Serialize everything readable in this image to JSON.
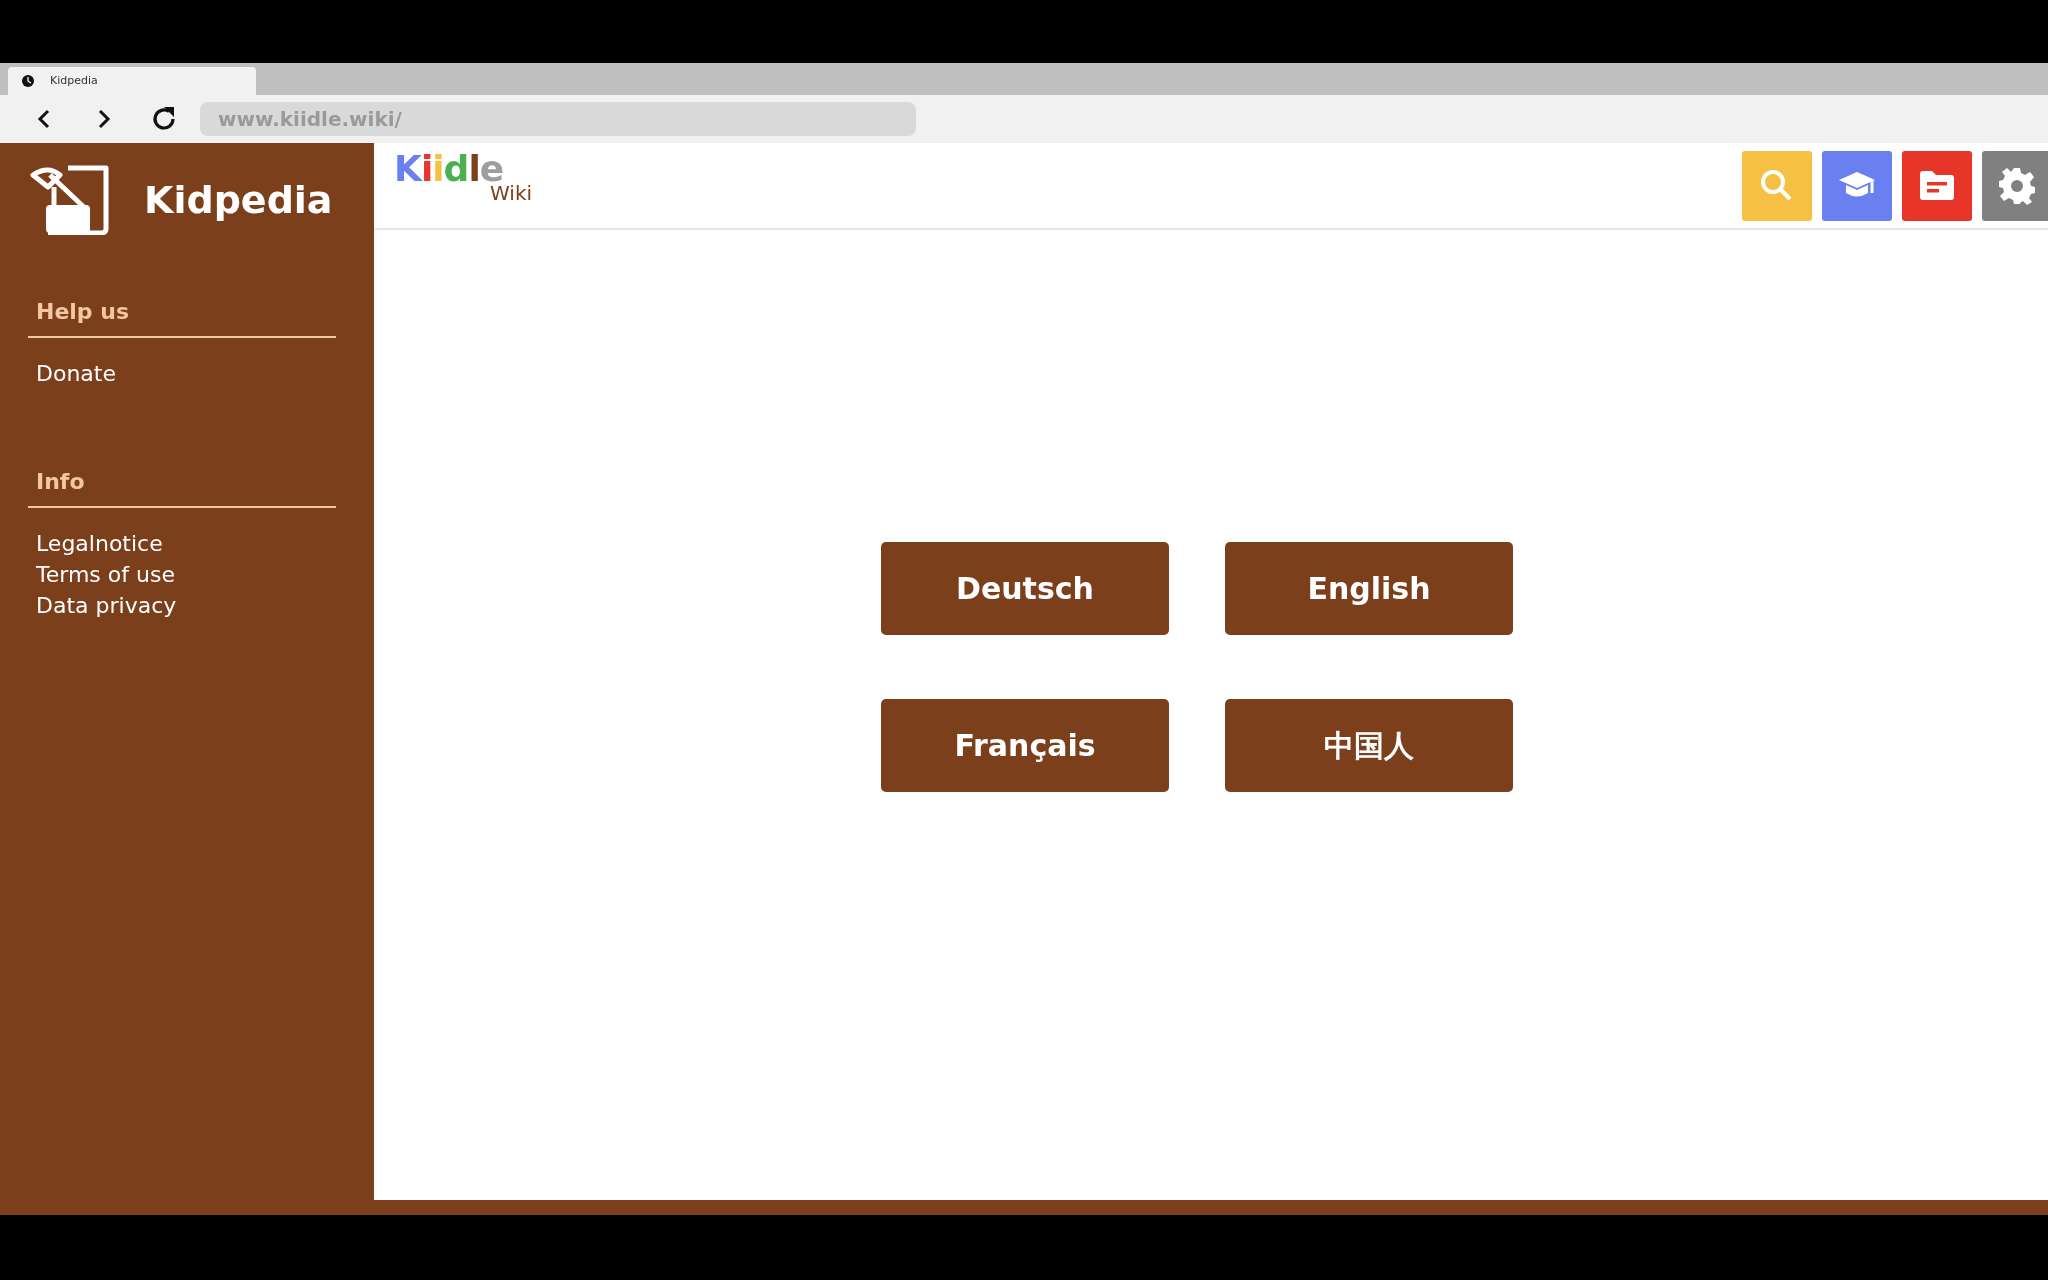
{
  "browser": {
    "tab_title": "Kidpedia",
    "url": "www.kiidle.wiki/"
  },
  "sidebar": {
    "title": "Kidpedia",
    "sections": [
      {
        "heading": "Help us",
        "links": [
          "Donate"
        ]
      },
      {
        "heading": "Info",
        "links": [
          "Legalnotice",
          "Terms of use",
          "Data privacy"
        ]
      }
    ]
  },
  "header": {
    "logo_letters": [
      {
        "text": "K",
        "color": "#6a80f0"
      },
      {
        "text": "i",
        "color": "#e8352a"
      },
      {
        "text": "i",
        "color": "#f5c043"
      },
      {
        "text": "d",
        "color": "#4caf50"
      },
      {
        "text": "l",
        "color": "#7b3f1c"
      },
      {
        "text": "e",
        "color": "#9e9e9e"
      }
    ],
    "logo_sub": "Wiki",
    "tools": [
      {
        "kind": "search",
        "color": "#f5c043"
      },
      {
        "kind": "learn",
        "color": "#6a80f0"
      },
      {
        "kind": "folder",
        "color": "#e8352a"
      },
      {
        "kind": "settings",
        "color": "#808080"
      }
    ]
  },
  "languages": [
    "Deutsch",
    "English",
    "Français",
    "中国人"
  ]
}
